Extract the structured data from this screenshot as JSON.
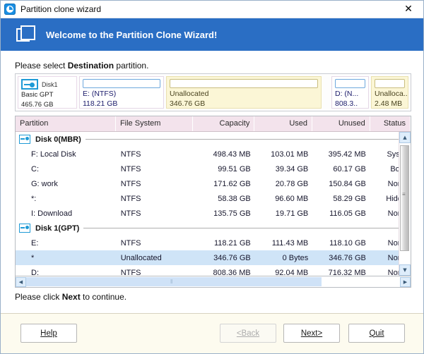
{
  "window": {
    "title": "Partition clone wizard",
    "title_icon": "app-logo-icon",
    "close_label": "✕"
  },
  "banner": {
    "title": "Welcome to the Partition Clone Wizard!",
    "icon": "windows-frames-icon",
    "background": "#2a6ec4"
  },
  "instruction": {
    "prefix": "Please select ",
    "emphasis": "Destination",
    "suffix": " partition."
  },
  "disk_map": {
    "disk": {
      "name": "Disk1",
      "type": "Basic GPT",
      "size": "465.76 GB",
      "icon": "hard-disk-icon"
    },
    "partitions": [
      {
        "label": "E: (NTFS)",
        "size": "118.21 GB",
        "kind": "ntfs"
      },
      {
        "label": "Unallocated",
        "size": "346.76 GB",
        "kind": "unallocated"
      },
      {
        "label": "D: (N...",
        "size": "808.3..",
        "kind": "ntfs"
      },
      {
        "label": "Unalloca..",
        "size": "2.48 MB",
        "kind": "unallocated"
      }
    ]
  },
  "table": {
    "columns": [
      {
        "key": "partition",
        "label": "Partition",
        "align": "left"
      },
      {
        "key": "filesystem",
        "label": "File System",
        "align": "left"
      },
      {
        "key": "capacity",
        "label": "Capacity",
        "align": "right"
      },
      {
        "key": "used",
        "label": "Used",
        "align": "right"
      },
      {
        "key": "unused",
        "label": "Unused",
        "align": "right"
      },
      {
        "key": "status",
        "label": "Status",
        "align": "right"
      }
    ],
    "groups": [
      {
        "label": "Disk 0(MBR)",
        "rows": [
          {
            "partition": "F: Local Disk",
            "filesystem": "NTFS",
            "capacity": "498.43 MB",
            "used": "103.01 MB",
            "unused": "395.42 MB",
            "status": "Syste",
            "selected": false
          },
          {
            "partition": "C:",
            "filesystem": "NTFS",
            "capacity": "99.51 GB",
            "used": "39.34 GB",
            "unused": "60.17 GB",
            "status": "Boot",
            "selected": false
          },
          {
            "partition": "G: work",
            "filesystem": "NTFS",
            "capacity": "171.62 GB",
            "used": "20.78 GB",
            "unused": "150.84 GB",
            "status": "None",
            "selected": false
          },
          {
            "partition": "*:",
            "filesystem": "NTFS",
            "capacity": "58.38 GB",
            "used": "96.60 MB",
            "unused": "58.29 GB",
            "status": "Hidde",
            "selected": false
          },
          {
            "partition": "I: Download",
            "filesystem": "NTFS",
            "capacity": "135.75 GB",
            "used": "19.71 GB",
            "unused": "116.05 GB",
            "status": "None",
            "selected": false
          }
        ]
      },
      {
        "label": "Disk 1(GPT)",
        "rows": [
          {
            "partition": "E:",
            "filesystem": "NTFS",
            "capacity": "118.21 GB",
            "used": "111.43 MB",
            "unused": "118.10 GB",
            "status": "None",
            "selected": false
          },
          {
            "partition": "*",
            "filesystem": "Unallocated",
            "capacity": "346.76 GB",
            "used": "0 Bytes",
            "unused": "346.76 GB",
            "status": "None",
            "selected": true
          },
          {
            "partition": "D:",
            "filesystem": "NTFS",
            "capacity": "808.36 MB",
            "used": "92.04 MB",
            "unused": "716.32 MB",
            "status": "None",
            "selected": false
          }
        ]
      }
    ]
  },
  "scrollbars": {
    "vertical_up": "▲",
    "vertical_down": "▼",
    "horizontal_left": "◀",
    "horizontal_right": "▶"
  },
  "footnote": {
    "prefix": "Please click ",
    "emphasis": "Next",
    "suffix": " to continue."
  },
  "buttons": {
    "help": {
      "label": "Help",
      "accel": "H",
      "disabled": false
    },
    "back": {
      "label": "<Back",
      "accel": "B",
      "disabled": true
    },
    "next": {
      "label": "Next>",
      "accel": "N",
      "disabled": false
    },
    "quit": {
      "label": "Quit",
      "accel": "Q",
      "disabled": false
    }
  }
}
